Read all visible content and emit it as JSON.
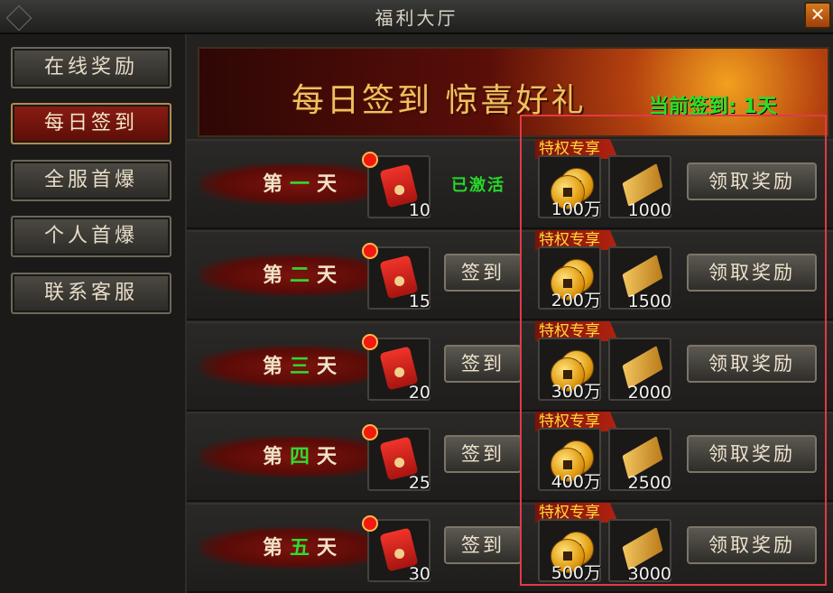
{
  "window": {
    "title": "福利大厅",
    "close_label": "✕"
  },
  "sidebar": {
    "items": [
      {
        "label": "在线奖励",
        "active": false
      },
      {
        "label": "每日签到",
        "active": true
      },
      {
        "label": "全服首爆",
        "active": false
      },
      {
        "label": "个人首爆",
        "active": false
      },
      {
        "label": "联系客服",
        "active": false
      }
    ]
  },
  "banner": {
    "title": "每日签到 惊喜好礼",
    "status": "当前签到: 1天"
  },
  "privilege_tag": "特权专享",
  "days": [
    {
      "prefix": "第",
      "num": "一",
      "suffix": "天",
      "packet_qty": "10",
      "action": "已激活",
      "action_type": "activated",
      "coin_qty": "100万",
      "ticket_qty": "1000",
      "claim_label": "领取奖励"
    },
    {
      "prefix": "第",
      "num": "二",
      "suffix": "天",
      "packet_qty": "15",
      "action": "签到",
      "action_type": "button",
      "coin_qty": "200万",
      "ticket_qty": "1500",
      "claim_label": "领取奖励"
    },
    {
      "prefix": "第",
      "num": "三",
      "suffix": "天",
      "packet_qty": "20",
      "action": "签到",
      "action_type": "button",
      "coin_qty": "300万",
      "ticket_qty": "2000",
      "claim_label": "领取奖励"
    },
    {
      "prefix": "第",
      "num": "四",
      "suffix": "天",
      "packet_qty": "25",
      "action": "签到",
      "action_type": "button",
      "coin_qty": "400万",
      "ticket_qty": "2500",
      "claim_label": "领取奖励"
    },
    {
      "prefix": "第",
      "num": "五",
      "suffix": "天",
      "packet_qty": "30",
      "action": "签到",
      "action_type": "button",
      "coin_qty": "500万",
      "ticket_qty": "3000",
      "claim_label": "领取奖励"
    }
  ],
  "colors": {
    "accent_green": "#2fdc2f",
    "highlight_frame": "#e23a45",
    "privilege_text": "#ffd93a"
  }
}
